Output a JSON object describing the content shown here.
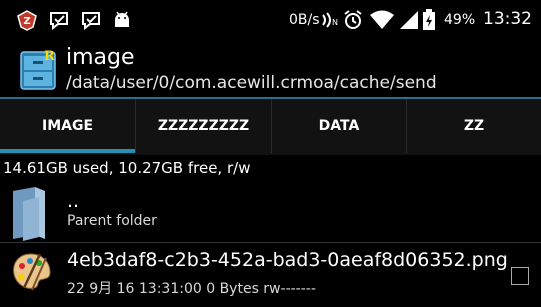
{
  "status_bar": {
    "speed": "0B/s",
    "battery": "49%",
    "time": "13:32",
    "icons": [
      "app-z-icon",
      "message-check-icon",
      "message-check-icon",
      "android-icon",
      "nfc-icon",
      "alarm-icon",
      "wifi-icon",
      "signal-icon",
      "battery-icon"
    ]
  },
  "header": {
    "title": "image",
    "path": "/data/user/0/com.acewill.crmoa/cache/send",
    "icon": "root-explorer-cabinet-icon"
  },
  "tabs": [
    {
      "label": "IMAGE",
      "active": true
    },
    {
      "label": "ZZZZZZZZZ",
      "active": false
    },
    {
      "label": "DATA",
      "active": false
    },
    {
      "label": "ZZ",
      "active": false
    }
  ],
  "storage_info": "14.61GB used, 10.27GB free, r/w",
  "entries": [
    {
      "name": "..",
      "detail": "Parent folder",
      "icon": "folder-icon"
    },
    {
      "name": "4eb3daf8-c2b3-452a-bad3-0aeaf8d06352.png",
      "detail": "22 9月 16 13:31:00  0 Bytes  rw-------",
      "icon": "paint-palette-icon"
    }
  ],
  "colors": {
    "accent": "#2b8fb3",
    "background": "#000000",
    "tabs_bg": "#121212"
  }
}
